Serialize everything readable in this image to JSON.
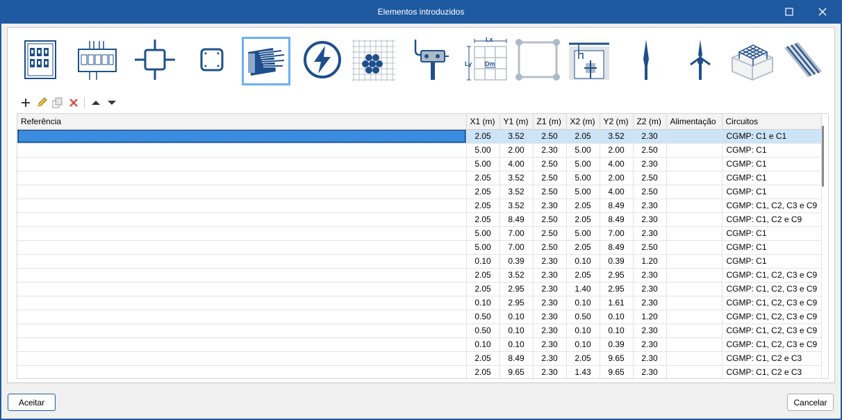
{
  "window": {
    "title": "Elementos introduzidos"
  },
  "icons": [
    {
      "name": "switchboard-panel-icon",
      "selected": false
    },
    {
      "name": "distribution-board-icon",
      "selected": false
    },
    {
      "name": "junction-box-icon",
      "selected": false
    },
    {
      "name": "connection-box-icon",
      "selected": false
    },
    {
      "name": "cable-icon",
      "selected": true
    },
    {
      "name": "lightning-icon",
      "selected": false
    },
    {
      "name": "earth-mesh-icon",
      "selected": false
    },
    {
      "name": "pole-connector-icon",
      "selected": false
    },
    {
      "name": "grid-dimensions-icon",
      "selected": false
    },
    {
      "name": "rectangle-nodes-icon",
      "selected": false
    },
    {
      "name": "earth-pit-icon",
      "selected": false
    },
    {
      "name": "lightning-rod-icon",
      "selected": false
    },
    {
      "name": "lightning-rod-multi-icon",
      "selected": false
    },
    {
      "name": "foundation-cage-icon",
      "selected": false
    },
    {
      "name": "stranded-conductor-icon",
      "selected": false
    }
  ],
  "grid_icon_labels": {
    "lx": "Lx",
    "ly": "Ly",
    "dm": "Dm"
  },
  "toolbar": [
    "add-icon",
    "edit-icon",
    "copy-icon",
    "delete-icon",
    "move-up-icon",
    "move-down-icon"
  ],
  "table": {
    "columns": [
      "Referência",
      "X1 (m)",
      "Y1 (m)",
      "Z1 (m)",
      "X2 (m)",
      "Y2 (m)",
      "Z2 (m)",
      "Alimentação",
      "Circuitos"
    ],
    "rows": [
      [
        "",
        "2.05",
        "3.52",
        "2.50",
        "2.05",
        "3.52",
        "2.30",
        "",
        "CGMP: C1 e C1"
      ],
      [
        "",
        "5.00",
        "2.00",
        "2.30",
        "5.00",
        "2.00",
        "2.50",
        "",
        "CGMP: C1"
      ],
      [
        "",
        "5.00",
        "4.00",
        "2.50",
        "5.00",
        "4.00",
        "2.30",
        "",
        "CGMP: C1"
      ],
      [
        "",
        "2.05",
        "3.52",
        "2.50",
        "5.00",
        "2.00",
        "2.50",
        "",
        "CGMP: C1"
      ],
      [
        "",
        "2.05",
        "3.52",
        "2.50",
        "5.00",
        "4.00",
        "2.50",
        "",
        "CGMP: C1"
      ],
      [
        "",
        "2.05",
        "3.52",
        "2.30",
        "2.05",
        "8.49",
        "2.30",
        "",
        "CGMP: C1, C2, C3 e C9"
      ],
      [
        "",
        "2.05",
        "8.49",
        "2.50",
        "2.05",
        "8.49",
        "2.30",
        "",
        "CGMP: C1, C2 e C9"
      ],
      [
        "",
        "5.00",
        "7.00",
        "2.50",
        "5.00",
        "7.00",
        "2.30",
        "",
        "CGMP: C1"
      ],
      [
        "",
        "5.00",
        "7.00",
        "2.50",
        "2.05",
        "8.49",
        "2.50",
        "",
        "CGMP: C1"
      ],
      [
        "",
        "0.10",
        "0.39",
        "2.30",
        "0.10",
        "0.39",
        "1.20",
        "",
        "CGMP: C1"
      ],
      [
        "",
        "2.05",
        "3.52",
        "2.30",
        "2.05",
        "2.95",
        "2.30",
        "",
        "CGMP: C1, C2, C3 e C9"
      ],
      [
        "",
        "2.05",
        "2.95",
        "2.30",
        "1.40",
        "2.95",
        "2.30",
        "",
        "CGMP: C1, C2, C3 e C9"
      ],
      [
        "",
        "0.10",
        "2.95",
        "2.30",
        "0.10",
        "1.61",
        "2.30",
        "",
        "CGMP: C1, C2, C3 e C9"
      ],
      [
        "",
        "0.50",
        "0.10",
        "2.30",
        "0.50",
        "0.10",
        "1.20",
        "",
        "CGMP: C1, C2, C3 e C9"
      ],
      [
        "",
        "0.50",
        "0.10",
        "2.30",
        "0.10",
        "0.10",
        "2.30",
        "",
        "CGMP: C1, C2, C3 e C9"
      ],
      [
        "",
        "0.10",
        "0.10",
        "2.30",
        "0.10",
        "0.39",
        "2.30",
        "",
        "CGMP: C1, C2, C3 e C9"
      ],
      [
        "",
        "2.05",
        "8.49",
        "2.30",
        "2.05",
        "9.65",
        "2.30",
        "",
        "CGMP: C1, C2 e C3"
      ],
      [
        "",
        "2.05",
        "9.65",
        "2.30",
        "1.43",
        "9.65",
        "2.30",
        "",
        "CGMP: C1, C2 e C3"
      ]
    ],
    "selected_row": 0
  },
  "buttons": {
    "ok": "Aceitar",
    "cancel": "Cancelar"
  },
  "colors": {
    "titlebar": "#1f5aa0",
    "icon_blue": "#1e4f8c",
    "selection": "#cce4f7",
    "selected_cell": "#3b8be0"
  }
}
